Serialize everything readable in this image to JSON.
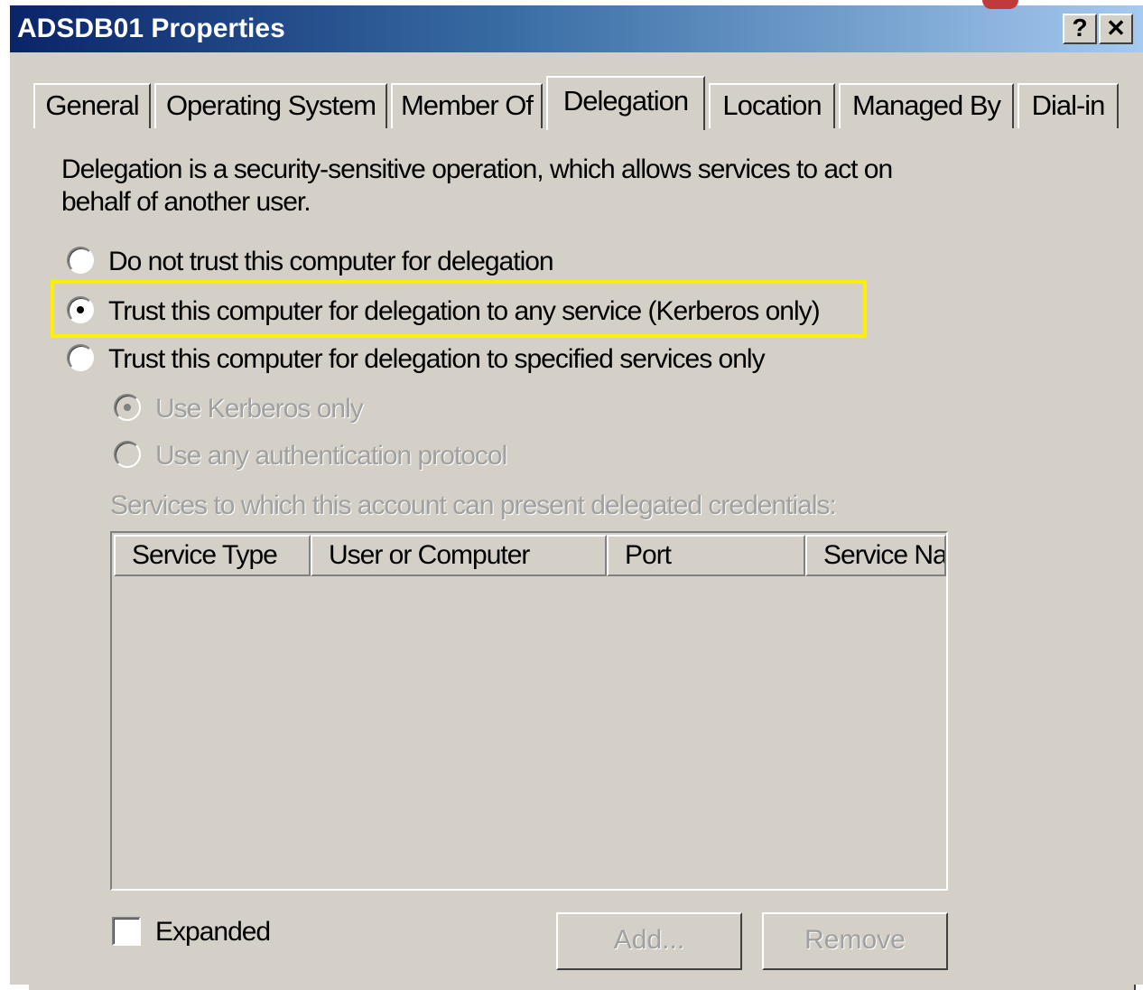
{
  "window": {
    "title": "ADSDB01 Properties",
    "help_label": "?",
    "close_label": "✕"
  },
  "tabs": [
    {
      "label": "General"
    },
    {
      "label": "Operating System"
    },
    {
      "label": "Member Of"
    },
    {
      "label": "Delegation",
      "active": true
    },
    {
      "label": "Location"
    },
    {
      "label": "Managed By"
    },
    {
      "label": "Dial-in"
    }
  ],
  "delegation": {
    "description_line1": "Delegation is a security-sensitive operation, which allows services to act on",
    "description_line2": "behalf of another user.",
    "options": [
      {
        "label": "Do not trust this computer for delegation",
        "selected": false
      },
      {
        "label": "Trust this computer for delegation to any service (Kerberos only)",
        "selected": true
      },
      {
        "label": "Trust this computer for delegation to specified services only",
        "selected": false
      }
    ],
    "sub_options": [
      {
        "label": "Use Kerberos only",
        "selected": true,
        "enabled": false
      },
      {
        "label": "Use any authentication protocol",
        "selected": false,
        "enabled": false
      }
    ],
    "services_label": "Services to which this account can present delegated credentials:",
    "columns": [
      "Service Type",
      "User or Computer",
      "Port",
      "Service Na"
    ],
    "rows": [],
    "expanded_label": "Expanded",
    "expanded_checked": false,
    "add_label": "Add...",
    "remove_label": "Remove",
    "highlight_color": "#ffef00"
  }
}
